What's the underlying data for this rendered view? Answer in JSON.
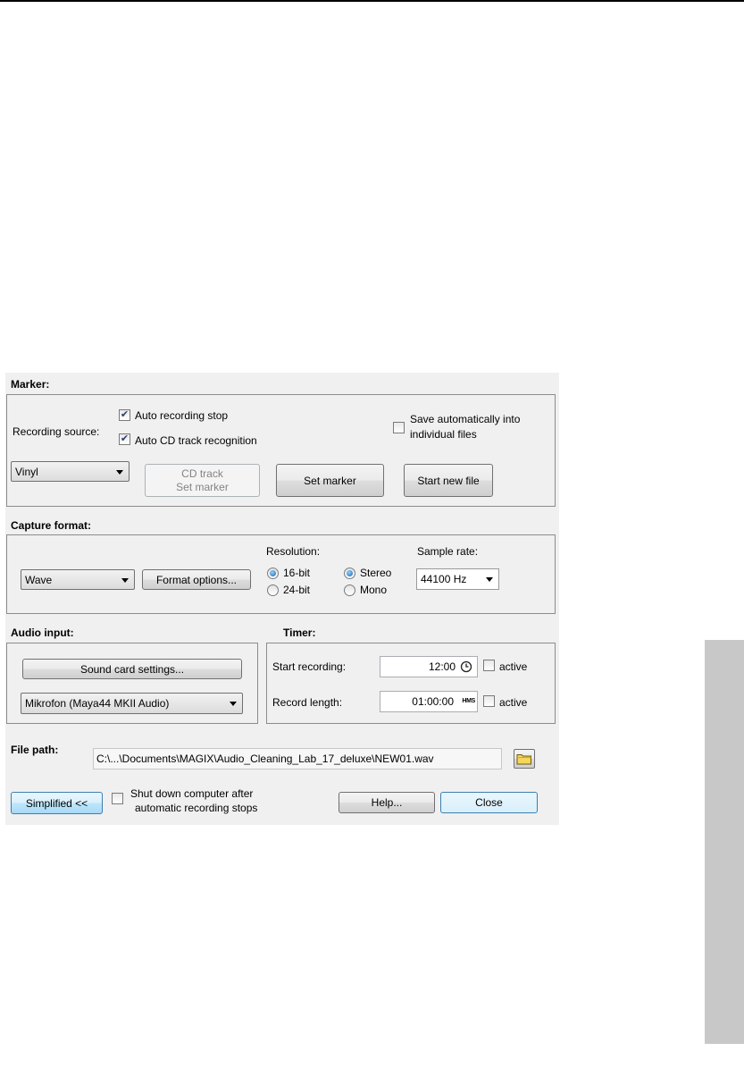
{
  "marker": {
    "title": "Marker:",
    "recording_source_label": "Recording source:",
    "auto_stop_label": "Auto recording stop",
    "auto_cd_label": "Auto CD track recognition",
    "save_individual_label_1": "Save automatically into",
    "save_individual_label_2": "individual files",
    "source_value": "Vinyl",
    "cd_track_label_1": "CD track",
    "cd_track_label_2": "Set marker",
    "set_marker_label": "Set marker",
    "start_new_file_label": "Start new file"
  },
  "capture": {
    "title": "Capture format:",
    "format_value": "Wave",
    "format_options_label": "Format options...",
    "resolution_label": "Resolution:",
    "bit16_label": "16-bit",
    "bit24_label": "24-bit",
    "stereo_label": "Stereo",
    "mono_label": "Mono",
    "sample_rate_label": "Sample rate:",
    "sample_rate_value": "44100 Hz"
  },
  "audio_input": {
    "title": "Audio input:",
    "sound_card_label": "Sound card settings...",
    "device_value": "Mikrofon (Maya44 MKII Audio)"
  },
  "timer": {
    "title": "Timer:",
    "start_recording_label": "Start recording:",
    "start_value": "12:00",
    "record_length_label": "Record length:",
    "length_value": "01:00:00",
    "hms_label": "HMS",
    "active_label": "active"
  },
  "file_path": {
    "title": "File path:",
    "value": "C:\\...\\Documents\\MAGIX\\Audio_Cleaning_Lab_17_deluxe\\NEW01.wav"
  },
  "footer": {
    "simplified_label": "Simplified <<",
    "shutdown_label_1": "Shut down computer after",
    "shutdown_label_2": "automatic recording stops",
    "help_label": "Help...",
    "close_label": "Close"
  }
}
